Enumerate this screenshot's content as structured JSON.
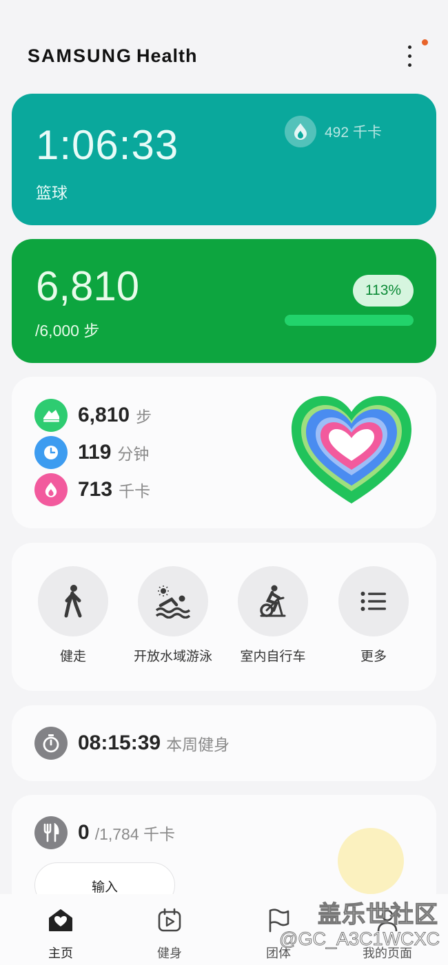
{
  "app": {
    "brand": "SAMSUNG",
    "product": "Health"
  },
  "colors": {
    "exercise": "#0aa89c",
    "steps": "#0da53f",
    "active_steps": "#2ecc71",
    "active_time": "#3d9cf0",
    "active_cal": "#f25a9d"
  },
  "exercise": {
    "duration": "1:06:33",
    "type": "篮球",
    "calories": "492 千卡",
    "icon": "flame-icon"
  },
  "steps": {
    "count": "6,810",
    "goal": "/6,000 步",
    "percent_label": "113%",
    "progress": 1.0
  },
  "activity_summary": {
    "items": [
      {
        "value": "6,810",
        "unit": "步",
        "icon": "shoe-icon"
      },
      {
        "value": "119",
        "unit": "分钟",
        "icon": "clock-icon"
      },
      {
        "value": "713",
        "unit": "千卡",
        "icon": "flame-icon"
      }
    ],
    "rings_icon": "activity-heart-icon"
  },
  "quick_start": {
    "items": [
      {
        "label": "健走",
        "icon": "walking-icon"
      },
      {
        "label": "开放水域游泳",
        "icon": "swimming-icon"
      },
      {
        "label": "室内自行车",
        "icon": "bike-icon"
      },
      {
        "label": "更多",
        "icon": "list-icon"
      }
    ]
  },
  "weekly": {
    "time": "08:15:39",
    "label": "本周健身",
    "icon": "stopwatch-icon"
  },
  "food": {
    "value": "0",
    "goal": "/1,784 千卡",
    "input_label": "输入",
    "icon": "fork-knife-icon"
  },
  "bottom_nav": {
    "items": [
      {
        "label": "主页",
        "icon": "home-heart-icon"
      },
      {
        "label": "健身",
        "icon": "calendar-play-icon"
      },
      {
        "label": "团体",
        "icon": "flag-icon"
      },
      {
        "label": "我的页面",
        "icon": "profile-icon"
      }
    ]
  },
  "watermark": {
    "site": "盖乐世社区",
    "user": "@GC_A3C1WCXC"
  }
}
